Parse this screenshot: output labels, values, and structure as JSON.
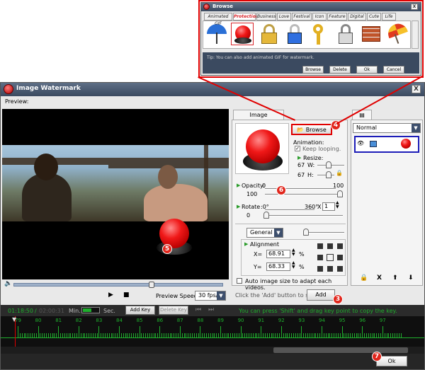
{
  "window": {
    "title": "Image Watermark",
    "close_glyph": "X"
  },
  "preview": {
    "label": "Preview:"
  },
  "playback": {
    "speed_label": "Preview Speed:",
    "speed_value": "30 fps/s"
  },
  "watermark_tab": {
    "label": "Image Watermark"
  },
  "browse_button": {
    "label": "Browse"
  },
  "animation": {
    "label": "Animation:",
    "keep_looping_label": "Keep looping."
  },
  "resize": {
    "label": "Resize:",
    "w_value": "67",
    "w_label": "W:",
    "h_value": "67",
    "h_label": "H:"
  },
  "opacity": {
    "label": "Opacity:",
    "min": "0",
    "max": "100",
    "value": "100",
    "fraction": 1.0
  },
  "rotate": {
    "label": "Rotate",
    "min": ":0°",
    "max": "360°",
    "times": "X",
    "spin_value": "1",
    "value": "0"
  },
  "blend": {
    "selected": "General"
  },
  "alignment": {
    "label": "Alignment",
    "x_label": "X=",
    "x_value": "68.91",
    "y_label": "Y=",
    "y_value": "68.33",
    "unit": "%"
  },
  "auto_size": {
    "label": "Auto image size to adapt each videos."
  },
  "add_row": {
    "hint": "Click the 'Add' button to start ->",
    "add_label": "Add"
  },
  "layers": {
    "mode": "Normal",
    "bottom_icons": [
      "lock-icon",
      "delete-icon",
      "up-arrow-icon",
      "down-arrow-icon"
    ],
    "delete_glyph": "X"
  },
  "timeline": {
    "current_time": "01:18:50",
    "total_time": "02:00:31",
    "min_label": "Min.",
    "sec_label": "Sec.",
    "add_key": "Add Key",
    "delete_key": "Delete Key",
    "hint": "You can press 'Shift' and drag key point to copy the key.",
    "ticks": [
      "79",
      "80",
      "81",
      "82",
      "83",
      "84",
      "85",
      "86",
      "87",
      "88",
      "89",
      "90",
      "91",
      "92",
      "93",
      "94",
      "95",
      "96",
      "97"
    ]
  },
  "ok_button": {
    "label": "Ok"
  },
  "markers": {
    "m4": "4",
    "m5": "5",
    "m6": "6",
    "m3": "3",
    "m7": "7"
  },
  "browse_dialog": {
    "title": "Browse",
    "tabs": [
      "Animated GIF",
      "Protection",
      "Business",
      "Love",
      "Festival",
      "Icon",
      "Feature",
      "Digital",
      "Cute",
      "Life"
    ],
    "active_tab": "Protection",
    "icons": [
      "umbrella-icon",
      "red-button-icon",
      "padlock-icon",
      "blue-lock-icon",
      "key-icon",
      "silver-lock-icon",
      "brick-wall-icon",
      "parasol-icon"
    ],
    "tip": "Tip: You can also add animated GIF for watermark.",
    "buttons": [
      "Browse",
      "Delete",
      "Ok",
      "Cancel"
    ]
  },
  "colors": {
    "accent_red": "#e00000",
    "timeline_green": "#1fae2d",
    "title_blue": "#3b4a60",
    "highlight_blue": "#1d1db8"
  }
}
